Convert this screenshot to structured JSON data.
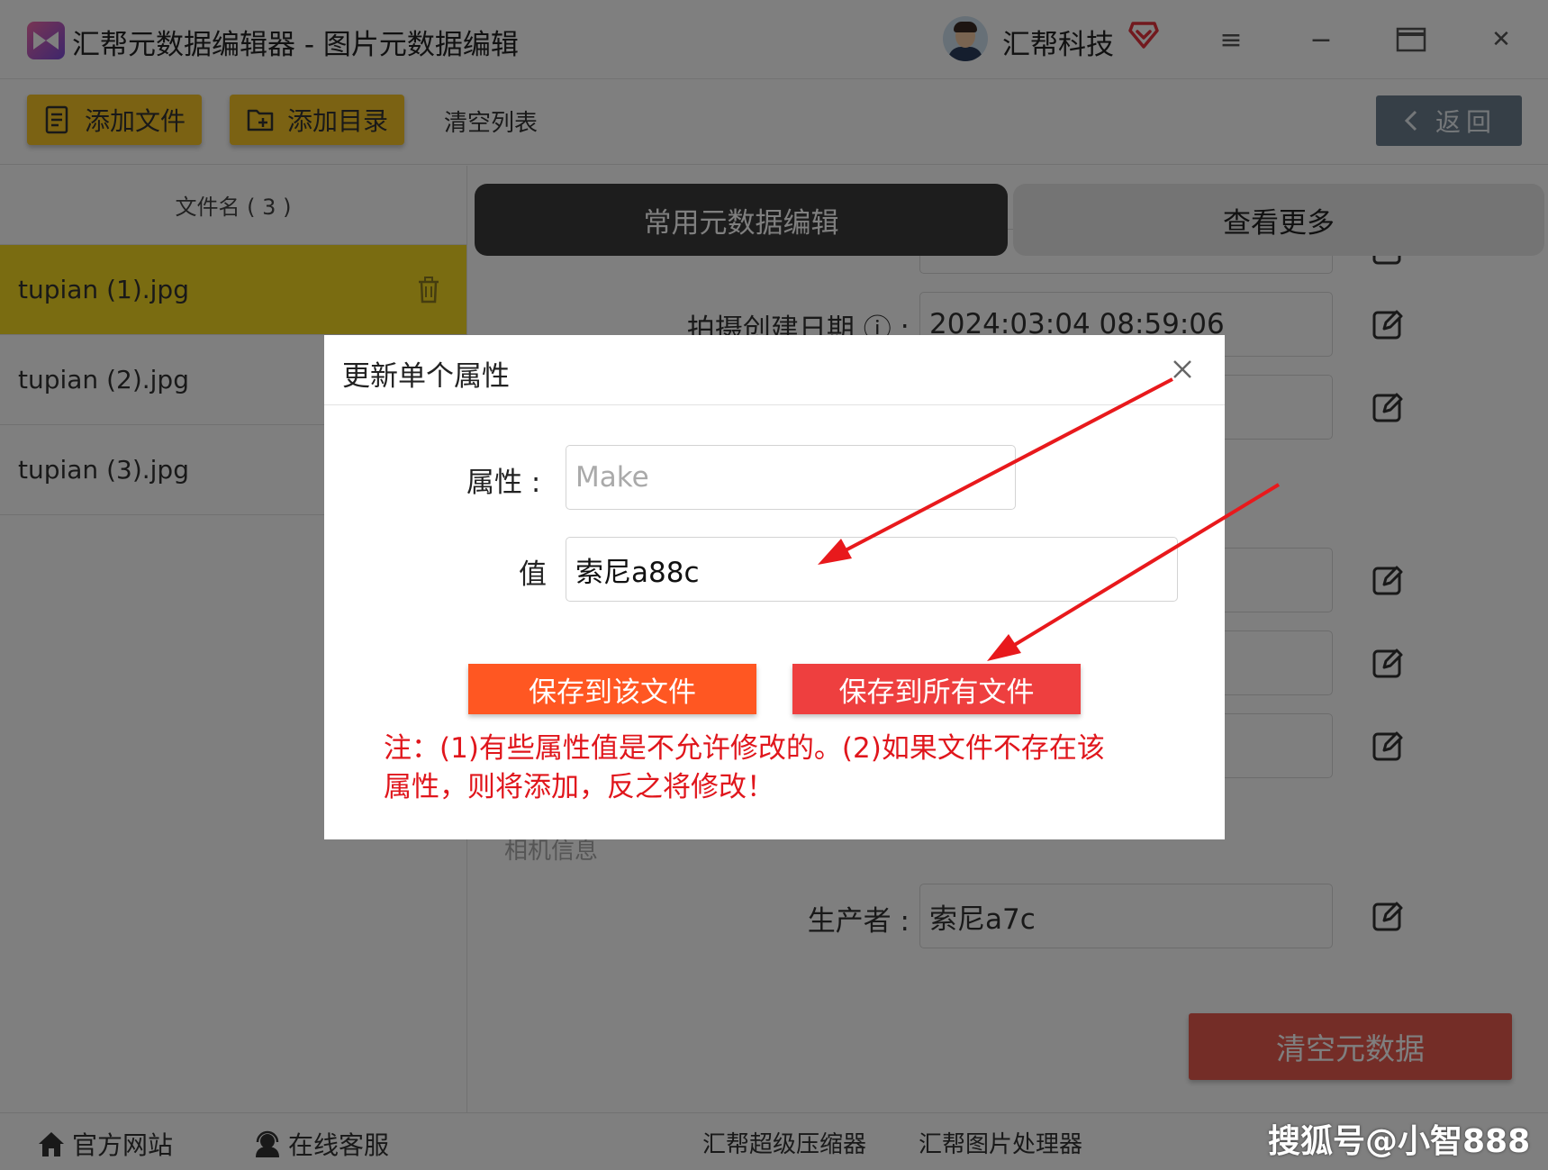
{
  "window": {
    "app_title": "汇帮元数据编辑器 - 图片元数据编辑",
    "company": "汇帮科技",
    "menu_glyph": "≡",
    "minimize_glyph": "−",
    "close_glyph": "✕"
  },
  "toolbar": {
    "add_file": "添加文件",
    "add_dir": "添加目录",
    "clear_list": "清空列表",
    "back": "返回"
  },
  "sidebar": {
    "header": "文件名 ( 3 )",
    "files": [
      {
        "name": "tupian (1).jpg",
        "selected": true
      },
      {
        "name": "tupian (2).jpg",
        "selected": false
      },
      {
        "name": "tupian (3).jpg",
        "selected": false
      }
    ]
  },
  "main": {
    "tabs": [
      {
        "label": "常用元数据编辑",
        "active": true
      },
      {
        "label": "查看更多",
        "active": false
      }
    ],
    "fields": {
      "capture_date": {
        "label": "拍摄创建日期 ⓘ :",
        "value": "2024:03:04 08:59:06"
      },
      "maker": {
        "label": "生产者 :",
        "value": "索尼a7c"
      }
    },
    "section_camera": "相机信息",
    "clear_metadata": "清空元数据"
  },
  "footer": {
    "website": "官方网站",
    "support": "在线客服",
    "compressor": "汇帮超级压缩器",
    "image_processor": "汇帮图片处理器"
  },
  "watermark": "搜狐号@小智888",
  "dialog": {
    "title": "更新单个属性",
    "property_label": "属性 :",
    "property_placeholder": "Make",
    "value_label": "值",
    "value_text": "索尼a88c",
    "save_this": "保存到该文件",
    "save_all": "保存到所有文件",
    "note": "注：(1)有些属性值是不允许修改的。(2)如果文件不存在该属性，则将添加，反之将修改！"
  },
  "colors": {
    "accent_yellow": "#f7c427",
    "selected_row": "#f5d823",
    "save_this_btn": "#ff5722",
    "save_all_btn": "#ee3f3f",
    "note_red": "#e0161c",
    "annotation_arrow": "#e8191c"
  },
  "icons": {
    "app": "app-logo-icon",
    "vip": "diamond-vip-icon",
    "menu": "menu-icon",
    "minimize": "minimize-icon",
    "maximize": "maximize-icon",
    "close": "close-icon",
    "add_file": "file-list-icon",
    "add_dir": "folder-add-icon",
    "back": "chevron-left-icon",
    "delete": "trash-icon",
    "edit": "edit-icon",
    "home": "home-icon",
    "support": "headset-icon"
  }
}
